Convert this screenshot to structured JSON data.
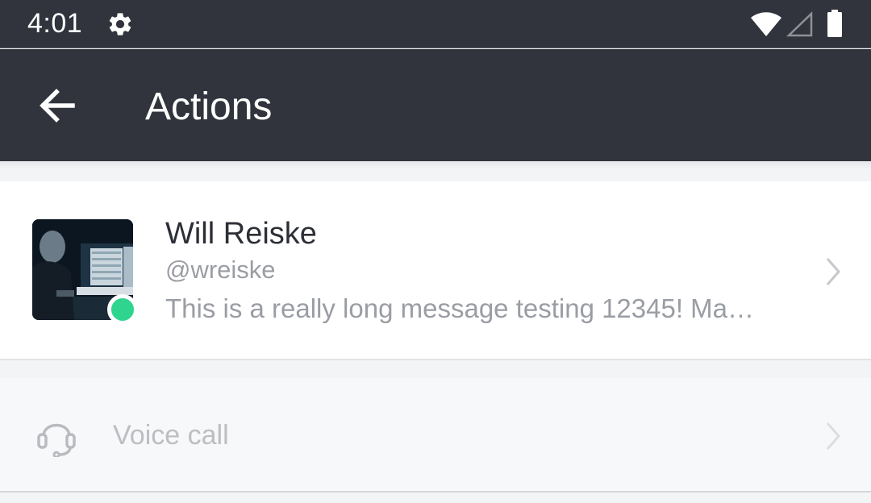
{
  "status_bar": {
    "time": "4:01",
    "icons": [
      "gear-icon",
      "wifi-icon",
      "cell-signal-icon",
      "battery-icon"
    ]
  },
  "app_bar": {
    "title": "Actions",
    "back_icon": "arrow-left-icon"
  },
  "user_card": {
    "name": "Will Reiske",
    "handle": "@wreiske",
    "message": "This is a really long message testing 12345! Ma…",
    "presence": "online",
    "presence_color": "#2fd58f"
  },
  "actions": [
    {
      "label": "Voice call",
      "icon": "headset-icon"
    }
  ],
  "colors": {
    "header_bg": "#31343c",
    "page_bg": "#f3f4f6"
  }
}
